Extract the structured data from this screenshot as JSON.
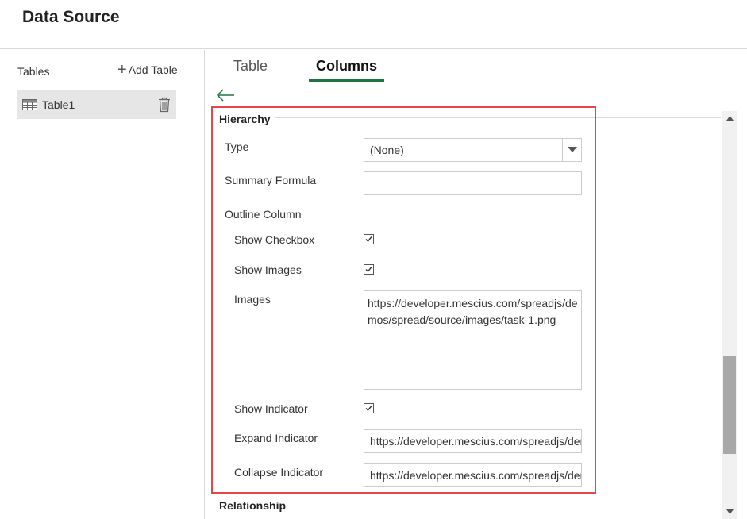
{
  "header": {
    "title": "Data Source"
  },
  "sidebar": {
    "tables_label": "Tables",
    "add_table_label": "Add Table",
    "items": [
      {
        "label": "Table1"
      }
    ]
  },
  "tabs": [
    {
      "label": "Table",
      "active": false
    },
    {
      "label": "Columns",
      "active": true
    }
  ],
  "hierarchy": {
    "section_title": "Hierarchy",
    "type_label": "Type",
    "type_value": "(None)",
    "summary_formula_label": "Summary Formula",
    "summary_formula_value": "",
    "outline_column_label": "Outline Column",
    "show_checkbox_label": "Show Checkbox",
    "show_checkbox_checked": true,
    "show_images_label": "Show Images",
    "show_images_checked": true,
    "images_label": "Images",
    "images_value": "https://developer.mescius.com/spreadjs/demos/spread/source/images/task-1.png",
    "show_indicator_label": "Show Indicator",
    "show_indicator_checked": true,
    "expand_indicator_label": "Expand Indicator",
    "expand_indicator_value": "https://developer.mescius.com/spreadjs/demos/spread/source/images/expand.png",
    "collapse_indicator_label": "Collapse Indicator",
    "collapse_indicator_value": "https://developer.mescius.com/spreadjs/demos/spread/source/images/collapse.png"
  },
  "relationship": {
    "section_title": "Relationship"
  },
  "colors": {
    "accent": "#217346",
    "highlight": "#e8444b",
    "selected_bg": "#e6e6e6"
  },
  "icons": {
    "add": "plus-icon",
    "table": "table-icon",
    "delete": "trash-icon",
    "back": "arrow-left-icon",
    "dropdown": "caret-down-icon",
    "check": "check-icon"
  }
}
